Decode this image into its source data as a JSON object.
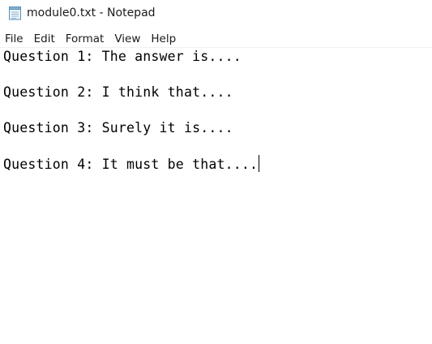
{
  "window": {
    "title": "module0.txt - Notepad",
    "app_icon": "notepad-icon"
  },
  "menu": {
    "items": [
      "File",
      "Edit",
      "Format",
      "View",
      "Help"
    ]
  },
  "editor": {
    "lines": [
      "Question 1: The answer is....",
      "",
      "Question 2: I think that....",
      "",
      "Question 3: Surely it is....",
      "",
      "Question 4: It must be that...."
    ]
  }
}
